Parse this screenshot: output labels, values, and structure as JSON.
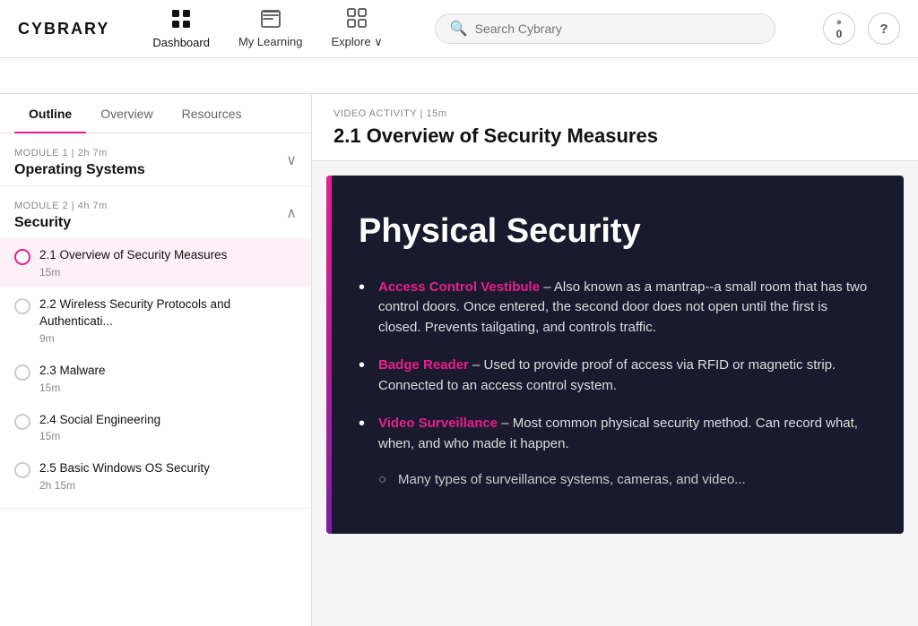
{
  "logo": "CYBRARY",
  "nav": {
    "items": [
      {
        "id": "dashboard",
        "label": "Dashboard",
        "icon": "⊞",
        "active": true
      },
      {
        "id": "my-learning",
        "label": "My Learning",
        "icon": "📖",
        "active": false
      },
      {
        "id": "explore",
        "label": "Explore ∨",
        "icon": "⊞",
        "active": false
      }
    ]
  },
  "search": {
    "placeholder": "Search Cybrary"
  },
  "navbar_right": {
    "score": "0",
    "help": "?"
  },
  "sidebar": {
    "tabs": [
      {
        "id": "outline",
        "label": "Outline",
        "active": true
      },
      {
        "id": "overview",
        "label": "Overview",
        "active": false
      },
      {
        "id": "resources",
        "label": "Resources",
        "active": false
      }
    ],
    "modules": [
      {
        "id": "module-1",
        "label": "MODULE 1  |  2h 7m",
        "title": "Operating Systems",
        "expanded": false,
        "lessons": []
      },
      {
        "id": "module-2",
        "label": "MODULE 2  |  4h 7m",
        "title": "Security",
        "expanded": true,
        "lessons": [
          {
            "id": "2.1",
            "title": "2.1 Overview of Security Measures",
            "duration": "15m",
            "active": true
          },
          {
            "id": "2.2",
            "title": "2.2 Wireless Security Protocols and Authenticati...",
            "duration": "9m",
            "active": false
          },
          {
            "id": "2.3",
            "title": "2.3 Malware",
            "duration": "15m",
            "active": false
          },
          {
            "id": "2.4",
            "title": "2.4 Social Engineering",
            "duration": "15m",
            "active": false
          },
          {
            "id": "2.5",
            "title": "2.5 Basic Windows OS Security",
            "duration": "2h 15m",
            "active": false
          }
        ]
      }
    ]
  },
  "content": {
    "activity_label": "VIDEO ACTIVITY | 15m",
    "title": "2.1 Overview of Security Measures",
    "slide": {
      "title": "Physical Security",
      "bullets": [
        {
          "term": "Access Control Vestibule",
          "text": " – Also known as a mantrap--a small room that has two control doors. Once entered, the second door does not open until the first is closed. Prevents tailgating, and controls traffic."
        },
        {
          "term": "Badge Reader",
          "text": " – Used to provide proof of access via RFID or magnetic strip. Connected to an access control system."
        },
        {
          "term": "Video Surveillance",
          "text": " – Most common physical security method. Can record what, when, and who made it happen.",
          "sub": "Many types of surveillance systems, cameras, and video..."
        }
      ]
    }
  }
}
